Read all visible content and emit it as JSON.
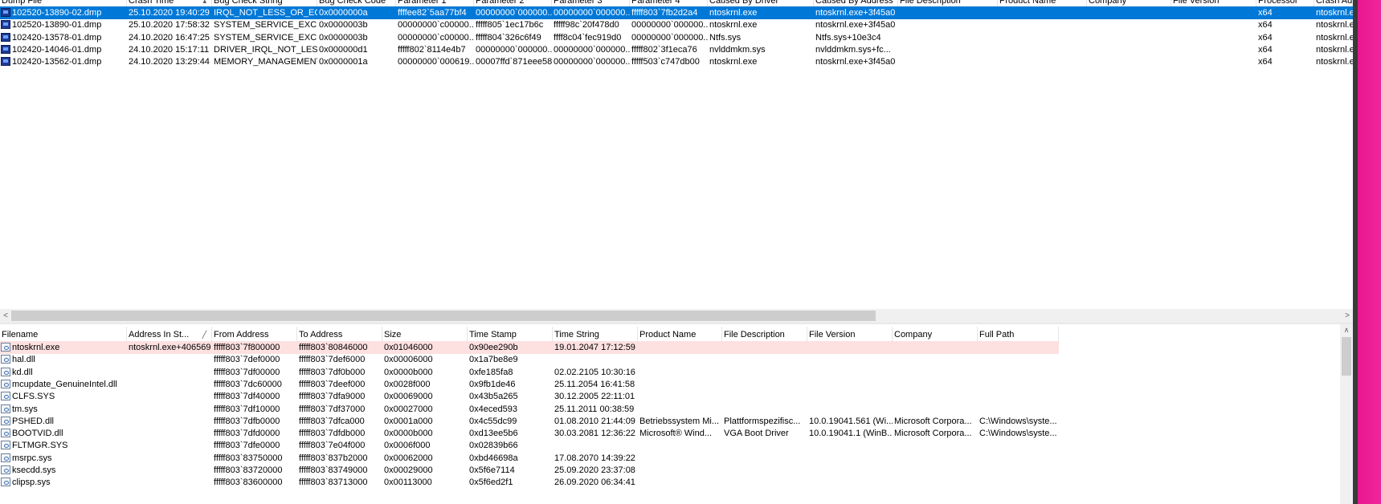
{
  "top_table": {
    "columns": [
      {
        "label": "Dump File",
        "w": 158
      },
      {
        "label": "Crash Time",
        "sort": "▴",
        "w": 106
      },
      {
        "label": "Bug Check String",
        "w": 131
      },
      {
        "label": "Bug Check Code",
        "w": 98
      },
      {
        "label": "Parameter 1",
        "w": 97
      },
      {
        "label": "Parameter 2",
        "w": 97
      },
      {
        "label": "Parameter 3",
        "w": 97
      },
      {
        "label": "Parameter 4",
        "w": 97
      },
      {
        "label": "Caused By Driver",
        "w": 132
      },
      {
        "label": "Caused By Address",
        "w": 105
      },
      {
        "label": "File Description",
        "w": 124
      },
      {
        "label": "Product Name",
        "w": 111
      },
      {
        "label": "Company",
        "w": 105
      },
      {
        "label": "File Version",
        "w": 106
      },
      {
        "label": "Processor",
        "w": 72
      },
      {
        "label": "Crash Address",
        "w": 48
      }
    ],
    "rows": [
      {
        "selected": true,
        "cells": [
          "102520-13890-02.dmp",
          "25.10.2020 19:40:29",
          "IRQL_NOT_LESS_OR_EQ...",
          "0x0000000a",
          "ffffee82`5aa77bf4",
          "00000000`000000...",
          "00000000`000000...",
          "fffff803`7fb2d2a4",
          "ntoskrnl.exe",
          "ntoskrnl.exe+3f45a0",
          "",
          "",
          "",
          "",
          "x64",
          "ntoskrnl.e"
        ]
      },
      {
        "selected": false,
        "cells": [
          "102520-13890-01.dmp",
          "25.10.2020 17:58:32",
          "SYSTEM_SERVICE_EXCEP...",
          "0x0000003b",
          "00000000`c00000...",
          "fffff805`1ec17b6c",
          "fffff98c`20f478d0",
          "00000000`000000...",
          "ntoskrnl.exe",
          "ntoskrnl.exe+3f45a0",
          "",
          "",
          "",
          "",
          "x64",
          "ntoskrnl.e"
        ]
      },
      {
        "selected": false,
        "cells": [
          "102420-13578-01.dmp",
          "24.10.2020 16:47:25",
          "SYSTEM_SERVICE_EXCEP...",
          "0x0000003b",
          "00000000`c00000...",
          "fffff804`326c6f49",
          "ffff8c04`fec919d0",
          "00000000`000000...",
          "Ntfs.sys",
          "Ntfs.sys+10e3c4",
          "",
          "",
          "",
          "",
          "x64",
          "ntoskrnl.e"
        ]
      },
      {
        "selected": false,
        "cells": [
          "102420-14046-01.dmp",
          "24.10.2020 15:17:11",
          "DRIVER_IRQL_NOT_LESS...",
          "0x000000d1",
          "fffff802`8114e4b7",
          "00000000`000000...",
          "00000000`000000...",
          "fffff802`3f1eca76",
          "nvlddmkm.sys",
          "nvlddmkm.sys+fc...",
          "",
          "",
          "",
          "",
          "x64",
          "ntoskrnl.e"
        ]
      },
      {
        "selected": false,
        "cells": [
          "102420-13562-01.dmp",
          "24.10.2020 13:29:44",
          "MEMORY_MANAGEMENT",
          "0x0000001a",
          "00000000`000619...",
          "00007ffd`871eee58",
          "00000000`000000...",
          "fffff503`c747db00",
          "ntoskrnl.exe",
          "ntoskrnl.exe+3f45a0",
          "",
          "",
          "",
          "",
          "x64",
          "ntoskrnl.e"
        ]
      }
    ]
  },
  "scrollbar": {
    "left_arrow": "<",
    "right_arrow": ">",
    "up_arrow": "∧"
  },
  "bottom_table": {
    "columns": [
      {
        "label": "Filename",
        "w": 158
      },
      {
        "label": "Address In St...",
        "sort": "╱",
        "w": 106
      },
      {
        "label": "From Address",
        "w": 106
      },
      {
        "label": "To Address",
        "w": 106
      },
      {
        "label": "Size",
        "w": 106
      },
      {
        "label": "Time Stamp",
        "w": 106
      },
      {
        "label": "Time String",
        "w": 106
      },
      {
        "label": "Product Name",
        "w": 105
      },
      {
        "label": "File Description",
        "w": 106
      },
      {
        "label": "File Version",
        "w": 106
      },
      {
        "label": "Company",
        "w": 106
      },
      {
        "label": "Full Path",
        "w": 101
      }
    ],
    "rows": [
      {
        "highlight": true,
        "cells": [
          "ntoskrnl.exe",
          "ntoskrnl.exe+406569",
          "fffff803`7f800000",
          "fffff803`80846000",
          "0x01046000",
          "0x90ee290b",
          "19.01.2047 17:12:59",
          "",
          "",
          "",
          "",
          ""
        ]
      },
      {
        "highlight": false,
        "cells": [
          "hal.dll",
          "",
          "fffff803`7def0000",
          "fffff803`7def6000",
          "0x00006000",
          "0x1a7be8e9",
          "",
          "",
          "",
          "",
          "",
          ""
        ]
      },
      {
        "highlight": false,
        "cells": [
          "kd.dll",
          "",
          "fffff803`7df00000",
          "fffff803`7df0b000",
          "0x0000b000",
          "0xfe185fa8",
          "02.02.2105 10:30:16",
          "",
          "",
          "",
          "",
          ""
        ]
      },
      {
        "highlight": false,
        "cells": [
          "mcupdate_GenuineIntel.dll",
          "",
          "fffff803`7dc60000",
          "fffff803`7deef000",
          "0x0028f000",
          "0x9fb1de46",
          "25.11.2054 16:41:58",
          "",
          "",
          "",
          "",
          ""
        ]
      },
      {
        "highlight": false,
        "cells": [
          "CLFS.SYS",
          "",
          "fffff803`7df40000",
          "fffff803`7dfa9000",
          "0x00069000",
          "0x43b5a265",
          "30.12.2005 22:11:01",
          "",
          "",
          "",
          "",
          ""
        ]
      },
      {
        "highlight": false,
        "cells": [
          "tm.sys",
          "",
          "fffff803`7df10000",
          "fffff803`7df37000",
          "0x00027000",
          "0x4eced593",
          "25.11.2011 00:38:59",
          "",
          "",
          "",
          "",
          ""
        ]
      },
      {
        "highlight": false,
        "cells": [
          "PSHED.dll",
          "",
          "fffff803`7dfb0000",
          "fffff803`7dfca000",
          "0x0001a000",
          "0x4c55dc99",
          "01.08.2010 21:44:09",
          "Betriebssystem Mi...",
          "Plattformspezifisc...",
          "10.0.19041.561 (Wi...",
          "Microsoft Corpora...",
          "C:\\Windows\\syste..."
        ]
      },
      {
        "highlight": false,
        "cells": [
          "BOOTVID.dll",
          "",
          "fffff803`7dfd0000",
          "fffff803`7dfdb000",
          "0x0000b000",
          "0xd13ee5b6",
          "30.03.2081 12:36:22",
          "Microsoft® Wind...",
          "VGA Boot Driver",
          "10.0.19041.1 (WinB...",
          "Microsoft Corpora...",
          "C:\\Windows\\syste..."
        ]
      },
      {
        "highlight": false,
        "cells": [
          "FLTMGR.SYS",
          "",
          "fffff803`7dfe0000",
          "fffff803`7e04f000",
          "0x0006f000",
          "0x02839b66",
          "",
          "",
          "",
          "",
          "",
          ""
        ]
      },
      {
        "highlight": false,
        "cells": [
          "msrpc.sys",
          "",
          "fffff803`83750000",
          "fffff803`837b2000",
          "0x00062000",
          "0xbd46698a",
          "17.08.2070 14:39:22",
          "",
          "",
          "",
          "",
          ""
        ]
      },
      {
        "highlight": false,
        "cells": [
          "ksecdd.sys",
          "",
          "fffff803`83720000",
          "fffff803`83749000",
          "0x00029000",
          "0x5f6e7114",
          "25.09.2020 23:37:08",
          "",
          "",
          "",
          "",
          ""
        ]
      },
      {
        "highlight": false,
        "cells": [
          "clipsp.sys",
          "",
          "fffff803`83600000",
          "fffff803`83713000",
          "0x00113000",
          "0x5f6ed2f1",
          "26.09.2020 06:34:41",
          "",
          "",
          "",
          "",
          ""
        ]
      }
    ]
  }
}
